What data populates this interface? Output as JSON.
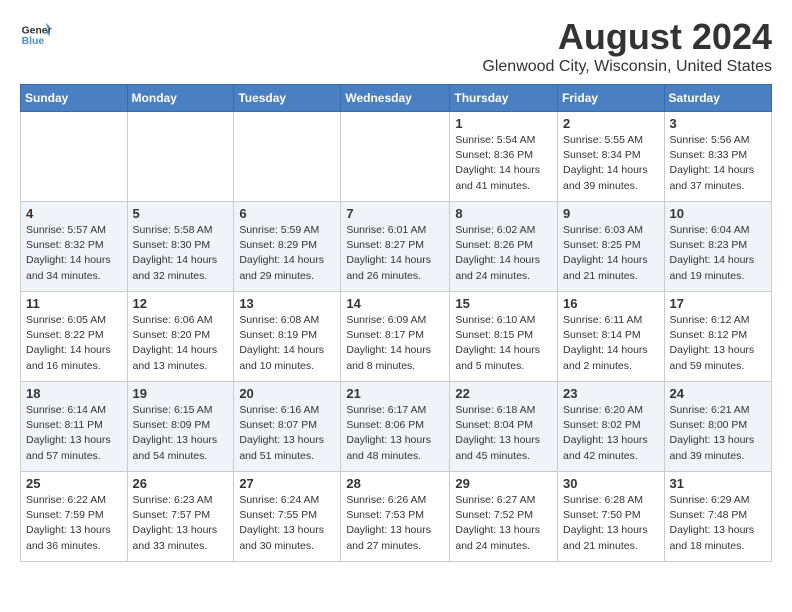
{
  "header": {
    "logo_line1": "General",
    "logo_line2": "Blue",
    "title": "August 2024",
    "subtitle": "Glenwood City, Wisconsin, United States"
  },
  "days_of_week": [
    "Sunday",
    "Monday",
    "Tuesday",
    "Wednesday",
    "Thursday",
    "Friday",
    "Saturday"
  ],
  "weeks": [
    [
      {
        "day": "",
        "info": ""
      },
      {
        "day": "",
        "info": ""
      },
      {
        "day": "",
        "info": ""
      },
      {
        "day": "",
        "info": ""
      },
      {
        "day": "1",
        "info": "Sunrise: 5:54 AM\nSunset: 8:36 PM\nDaylight: 14 hours and 41 minutes."
      },
      {
        "day": "2",
        "info": "Sunrise: 5:55 AM\nSunset: 8:34 PM\nDaylight: 14 hours and 39 minutes."
      },
      {
        "day": "3",
        "info": "Sunrise: 5:56 AM\nSunset: 8:33 PM\nDaylight: 14 hours and 37 minutes."
      }
    ],
    [
      {
        "day": "4",
        "info": "Sunrise: 5:57 AM\nSunset: 8:32 PM\nDaylight: 14 hours and 34 minutes."
      },
      {
        "day": "5",
        "info": "Sunrise: 5:58 AM\nSunset: 8:30 PM\nDaylight: 14 hours and 32 minutes."
      },
      {
        "day": "6",
        "info": "Sunrise: 5:59 AM\nSunset: 8:29 PM\nDaylight: 14 hours and 29 minutes."
      },
      {
        "day": "7",
        "info": "Sunrise: 6:01 AM\nSunset: 8:27 PM\nDaylight: 14 hours and 26 minutes."
      },
      {
        "day": "8",
        "info": "Sunrise: 6:02 AM\nSunset: 8:26 PM\nDaylight: 14 hours and 24 minutes."
      },
      {
        "day": "9",
        "info": "Sunrise: 6:03 AM\nSunset: 8:25 PM\nDaylight: 14 hours and 21 minutes."
      },
      {
        "day": "10",
        "info": "Sunrise: 6:04 AM\nSunset: 8:23 PM\nDaylight: 14 hours and 19 minutes."
      }
    ],
    [
      {
        "day": "11",
        "info": "Sunrise: 6:05 AM\nSunset: 8:22 PM\nDaylight: 14 hours and 16 minutes."
      },
      {
        "day": "12",
        "info": "Sunrise: 6:06 AM\nSunset: 8:20 PM\nDaylight: 14 hours and 13 minutes."
      },
      {
        "day": "13",
        "info": "Sunrise: 6:08 AM\nSunset: 8:19 PM\nDaylight: 14 hours and 10 minutes."
      },
      {
        "day": "14",
        "info": "Sunrise: 6:09 AM\nSunset: 8:17 PM\nDaylight: 14 hours and 8 minutes."
      },
      {
        "day": "15",
        "info": "Sunrise: 6:10 AM\nSunset: 8:15 PM\nDaylight: 14 hours and 5 minutes."
      },
      {
        "day": "16",
        "info": "Sunrise: 6:11 AM\nSunset: 8:14 PM\nDaylight: 14 hours and 2 minutes."
      },
      {
        "day": "17",
        "info": "Sunrise: 6:12 AM\nSunset: 8:12 PM\nDaylight: 13 hours and 59 minutes."
      }
    ],
    [
      {
        "day": "18",
        "info": "Sunrise: 6:14 AM\nSunset: 8:11 PM\nDaylight: 13 hours and 57 minutes."
      },
      {
        "day": "19",
        "info": "Sunrise: 6:15 AM\nSunset: 8:09 PM\nDaylight: 13 hours and 54 minutes."
      },
      {
        "day": "20",
        "info": "Sunrise: 6:16 AM\nSunset: 8:07 PM\nDaylight: 13 hours and 51 minutes."
      },
      {
        "day": "21",
        "info": "Sunrise: 6:17 AM\nSunset: 8:06 PM\nDaylight: 13 hours and 48 minutes."
      },
      {
        "day": "22",
        "info": "Sunrise: 6:18 AM\nSunset: 8:04 PM\nDaylight: 13 hours and 45 minutes."
      },
      {
        "day": "23",
        "info": "Sunrise: 6:20 AM\nSunset: 8:02 PM\nDaylight: 13 hours and 42 minutes."
      },
      {
        "day": "24",
        "info": "Sunrise: 6:21 AM\nSunset: 8:00 PM\nDaylight: 13 hours and 39 minutes."
      }
    ],
    [
      {
        "day": "25",
        "info": "Sunrise: 6:22 AM\nSunset: 7:59 PM\nDaylight: 13 hours and 36 minutes."
      },
      {
        "day": "26",
        "info": "Sunrise: 6:23 AM\nSunset: 7:57 PM\nDaylight: 13 hours and 33 minutes."
      },
      {
        "day": "27",
        "info": "Sunrise: 6:24 AM\nSunset: 7:55 PM\nDaylight: 13 hours and 30 minutes."
      },
      {
        "day": "28",
        "info": "Sunrise: 6:26 AM\nSunset: 7:53 PM\nDaylight: 13 hours and 27 minutes."
      },
      {
        "day": "29",
        "info": "Sunrise: 6:27 AM\nSunset: 7:52 PM\nDaylight: 13 hours and 24 minutes."
      },
      {
        "day": "30",
        "info": "Sunrise: 6:28 AM\nSunset: 7:50 PM\nDaylight: 13 hours and 21 minutes."
      },
      {
        "day": "31",
        "info": "Sunrise: 6:29 AM\nSunset: 7:48 PM\nDaylight: 13 hours and 18 minutes."
      }
    ]
  ]
}
